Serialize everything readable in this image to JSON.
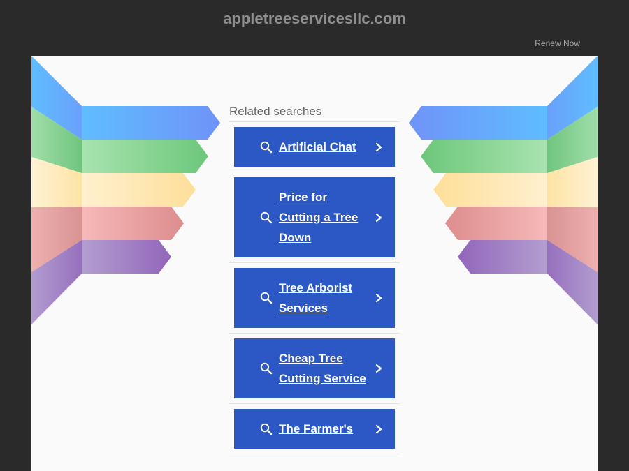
{
  "header": {
    "domain": "appletreeservicesllc.com",
    "renew_label": "Renew Now"
  },
  "related": {
    "heading": "Related searches",
    "items": [
      {
        "label": "Artificial Chat",
        "icon": "search-icon",
        "arrow": "chevron-right-icon"
      },
      {
        "label": "Price for Cutting a Tree Down",
        "icon": "search-icon",
        "arrow": "chevron-right-icon"
      },
      {
        "label": "Tree Arborist Services",
        "icon": "search-icon",
        "arrow": "chevron-right-icon"
      },
      {
        "label": "Cheap Tree Cutting Service",
        "icon": "search-icon",
        "arrow": "chevron-right-icon"
      },
      {
        "label": "The Farmer's",
        "icon": "search-icon",
        "arrow": "chevron-right-icon"
      }
    ]
  },
  "colors": {
    "page_background": "#2a2a2a",
    "panel_background": "#fafafa",
    "result_button": "#2c58c6",
    "stripe_blue": "#6aa8ff",
    "stripe_green": "#7fd08a",
    "stripe_yellow": "#fde5a7",
    "stripe_red": "#eaa6a6",
    "stripe_purple": "#a88bc9"
  }
}
